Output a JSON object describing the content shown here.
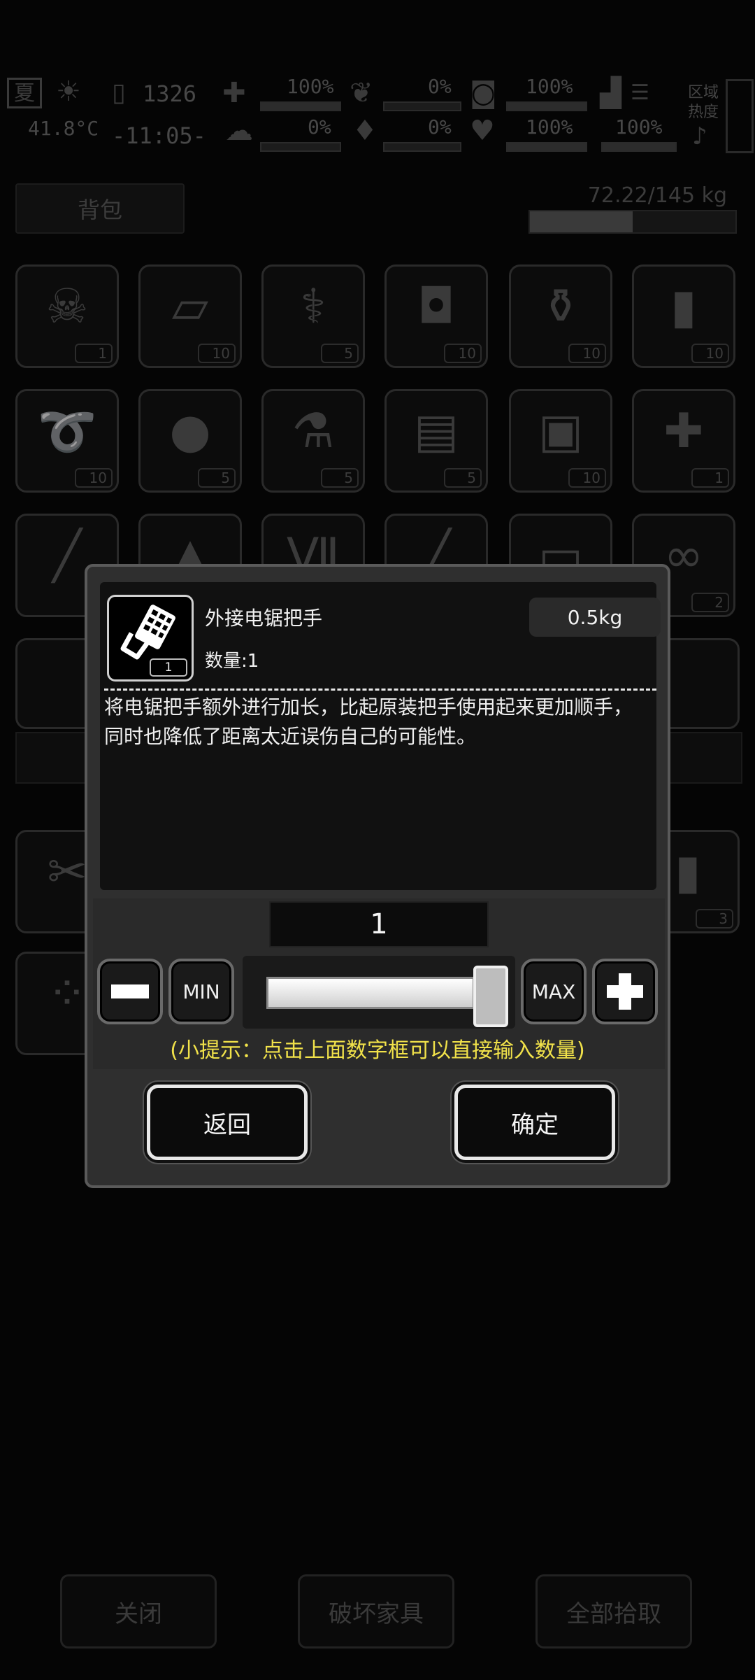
{
  "status": {
    "season": "夏",
    "temperature": "41.8°C",
    "day": "1326",
    "time": "-11:05-",
    "health_pct": "100%",
    "hunger_pct": "0%",
    "gear_pct": "100%",
    "injury_pct": "0%",
    "bleed_pct": "0%",
    "heart_pct": "100%",
    "stamina_pct": "100%",
    "zone_label": "区域热度"
  },
  "backpack": {
    "tab_label": "背包",
    "weight_text": "72.22/145 kg",
    "weight_fraction": 0.5
  },
  "grid": {
    "row1": [
      {
        "icon": "medusa-icon",
        "glyph": "☠",
        "count": "1"
      },
      {
        "icon": "bandage-roll-icon",
        "glyph": "▱",
        "count": "10"
      },
      {
        "icon": "syringe-icon",
        "glyph": "⚕",
        "count": "5"
      },
      {
        "icon": "canned-food-icon",
        "glyph": "◘",
        "count": "10"
      },
      {
        "icon": "water-bottle-icon",
        "glyph": "⚱",
        "count": "10"
      },
      {
        "icon": "energy-bar-icon",
        "glyph": "▮",
        "count": "10"
      }
    ],
    "row2": [
      {
        "icon": "rope-icon",
        "glyph": "➰",
        "count": "10"
      },
      {
        "icon": "seeds-icon",
        "glyph": "●",
        "count": "5"
      },
      {
        "icon": "pill-bottle-icon",
        "glyph": "⚗",
        "count": "5"
      },
      {
        "icon": "toolbox-icon",
        "glyph": "▤",
        "count": "5"
      },
      {
        "icon": "repair-kit-icon",
        "glyph": "▣",
        "count": "10"
      },
      {
        "icon": "adrenaline-syringe-icon",
        "glyph": "✚",
        "count": "1"
      }
    ],
    "row3": [
      {
        "icon": "rod-icon",
        "glyph": "╱",
        "count": ""
      },
      {
        "icon": "spike-icon",
        "glyph": "▲",
        "count": ""
      },
      {
        "icon": "tube-icon",
        "glyph": "Ⅶ",
        "count": ""
      },
      {
        "icon": "stick-icon",
        "glyph": "╱",
        "count": ""
      },
      {
        "icon": "card-icon",
        "glyph": "▭",
        "count": ""
      },
      {
        "icon": "spring-icon",
        "glyph": "∞",
        "count": "2"
      }
    ]
  },
  "bottom_buttons": {
    "close": "关闭",
    "destroy": "破坏家具",
    "pickup_all": "全部拾取"
  },
  "dialog": {
    "item_name": "外接电锯把手",
    "item_quantity_label": "数量:1",
    "item_icon_count": "1",
    "item_weight": "0.5kg",
    "description": "将电锯把手额外进行加长，比起原装把手使用起来更加顺手，同时也降低了距离太近误伤自己的可能性。",
    "quantity_value": "1",
    "slider_fraction": 1.0,
    "min_label": "MIN",
    "max_label": "MAX",
    "hint": "(小提示：点击上面数字框可以直接输入数量)",
    "back_label": "返回",
    "confirm_label": "确定"
  }
}
